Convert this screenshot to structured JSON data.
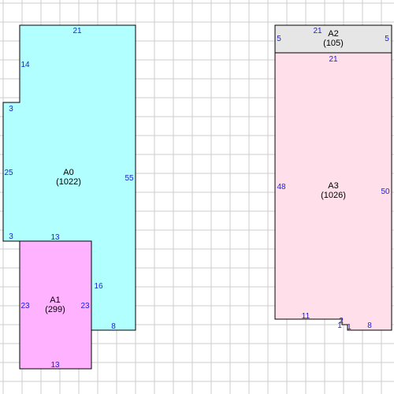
{
  "colors": {
    "grid": "#cccccc",
    "outline": "#000000",
    "dimension_text": "#1a1ae6"
  },
  "areas": [
    {
      "name": "A0",
      "area": "(1022)",
      "fill": "#b2ffff"
    },
    {
      "name": "A1",
      "area": "(299)",
      "fill": "#ffb2ff"
    },
    {
      "name": "A2",
      "area": "(105)",
      "fill": "#e6e6e6"
    },
    {
      "name": "A3",
      "area": "(1026)",
      "fill": "#ffe0ea"
    }
  ],
  "dimensions": {
    "a0_top": "21",
    "a0_left_upper": "14",
    "a0_notch_upper": "3",
    "a0_left_mid": "25",
    "a0_notch_lower": "3",
    "a0_bottom_mid": "13",
    "a0_right": "55",
    "a0_inner_right": "16",
    "a0_bottom_right": "8",
    "a1_left": "23",
    "a1_right": "23",
    "a1_bottom": "13",
    "a2_top": "21",
    "a2_left": "5",
    "a2_right": "5",
    "a3_top": "21",
    "a3_left": "48",
    "a3_right": "50",
    "a3_bottom_left": "11",
    "a3_step_a": "2",
    "a3_step_b": "1",
    "a3_step_c": "1",
    "a3_bottom_right": "8"
  }
}
